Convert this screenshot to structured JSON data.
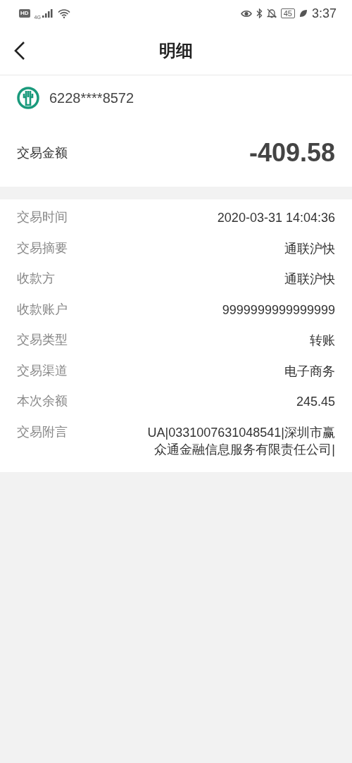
{
  "status_bar": {
    "hd": "HD",
    "network": "4G",
    "battery": "45",
    "time": "3:37"
  },
  "header": {
    "title": "明细"
  },
  "card": {
    "number": "6228****8572"
  },
  "amount": {
    "label": "交易金额",
    "value": "-409.58"
  },
  "details": [
    {
      "label": "交易时间",
      "value": "2020-03-31 14:04:36"
    },
    {
      "label": "交易摘要",
      "value": "通联沪快"
    },
    {
      "label": "收款方",
      "value": "通联沪快"
    },
    {
      "label": "收款账户",
      "value": "9999999999999999"
    },
    {
      "label": "交易类型",
      "value": "转账"
    },
    {
      "label": "交易渠道",
      "value": "电子商务"
    },
    {
      "label": "本次余额",
      "value": "245.45"
    },
    {
      "label": "交易附言",
      "value": "UA|0331007631048541|深圳市赢众通金融信息服务有限责任公司|"
    }
  ]
}
